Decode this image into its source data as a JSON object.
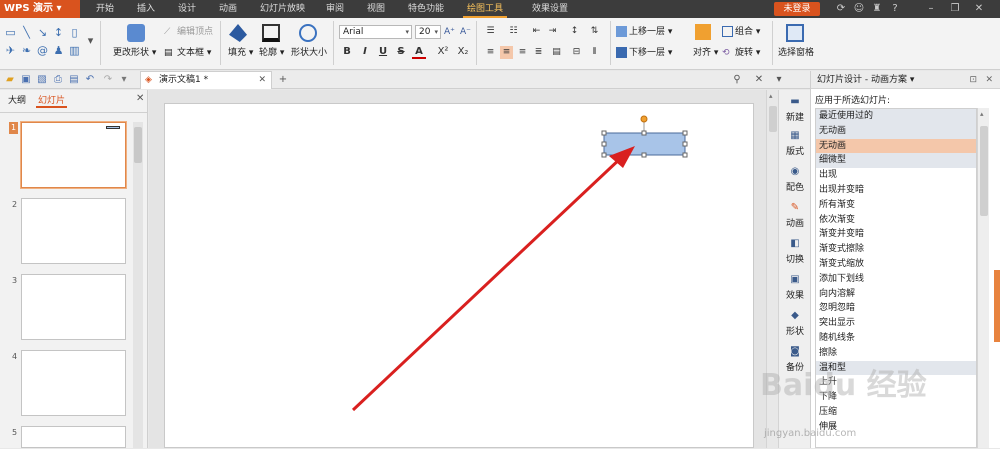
{
  "app": {
    "name": "WPS 演示",
    "login_label": "未登录"
  },
  "menu": {
    "tabs": [
      "开始",
      "插入",
      "设计",
      "动画",
      "幻灯片放映",
      "审阅",
      "视图",
      "特色功能",
      "绘图工具",
      "效果设置"
    ],
    "active_tab": "绘图工具",
    "right_icons": [
      "refresh-icon",
      "skin-icon",
      "shirt-icon",
      "help-icon",
      "minimize-icon",
      "restore-icon",
      "close-icon"
    ]
  },
  "ribbon": {
    "edit_vertices": "编辑顶点",
    "change_shape": "更改形状",
    "text_box": "文本框",
    "fill": "填充",
    "outline": "轮廓",
    "shape_size": "形状大小",
    "font_name": "Arial",
    "font_size": "20",
    "bold": "B",
    "italic": "I",
    "underline": "U",
    "strike": "S",
    "fontcolor": "A",
    "superscript": "X²",
    "subscript": "X₂",
    "bring_forward": "上移一层",
    "send_backward": "下移一层",
    "group": "组合",
    "align": "对齐",
    "rotate": "旋转",
    "selection_pane": "选择窗格"
  },
  "document": {
    "tab_title": "演示文稿1 *"
  },
  "left_panel": {
    "tabs": [
      "大纲",
      "幻灯片"
    ],
    "active_tab": "幻灯片",
    "slides": [
      "1",
      "2",
      "3",
      "4",
      "5"
    ]
  },
  "side_tools": [
    "新建",
    "版式",
    "配色",
    "动画",
    "切换",
    "效果",
    "形状",
    "备份"
  ],
  "task_pane": {
    "title": "幻灯片设计 - 动画方案",
    "apply_label": "应用于所选幻灯片:",
    "effects": [
      {
        "label": "最近使用过的",
        "type": "cat"
      },
      {
        "label": "无动画",
        "type": "cat"
      },
      {
        "label": "无动画",
        "type": "sel"
      },
      {
        "label": "细微型",
        "type": "cat"
      },
      {
        "label": "出现",
        "type": "item"
      },
      {
        "label": "出现并变暗",
        "type": "item"
      },
      {
        "label": "所有渐变",
        "type": "item"
      },
      {
        "label": "依次渐变",
        "type": "item"
      },
      {
        "label": "渐变并变暗",
        "type": "item"
      },
      {
        "label": "渐变式擦除",
        "type": "item"
      },
      {
        "label": "渐变式缩放",
        "type": "item"
      },
      {
        "label": "添加下划线",
        "type": "item"
      },
      {
        "label": "向内溶解",
        "type": "item"
      },
      {
        "label": "忽明忽暗",
        "type": "item"
      },
      {
        "label": "突出显示",
        "type": "item"
      },
      {
        "label": "随机线条",
        "type": "item"
      },
      {
        "label": "擦除",
        "type": "item"
      },
      {
        "label": "温和型",
        "type": "cat"
      },
      {
        "label": "上升",
        "type": "item"
      },
      {
        "label": "下降",
        "type": "item"
      },
      {
        "label": "压缩",
        "type": "item"
      },
      {
        "label": "伸展",
        "type": "item"
      }
    ]
  },
  "watermark": {
    "text": "Baidu 经验",
    "url": "jingyan.baidu.com"
  },
  "colors": {
    "accent": "#d9531e",
    "selection": "#f4c7aa",
    "arrow": "#d9201f",
    "shape_fill": "#a8c4e8"
  }
}
